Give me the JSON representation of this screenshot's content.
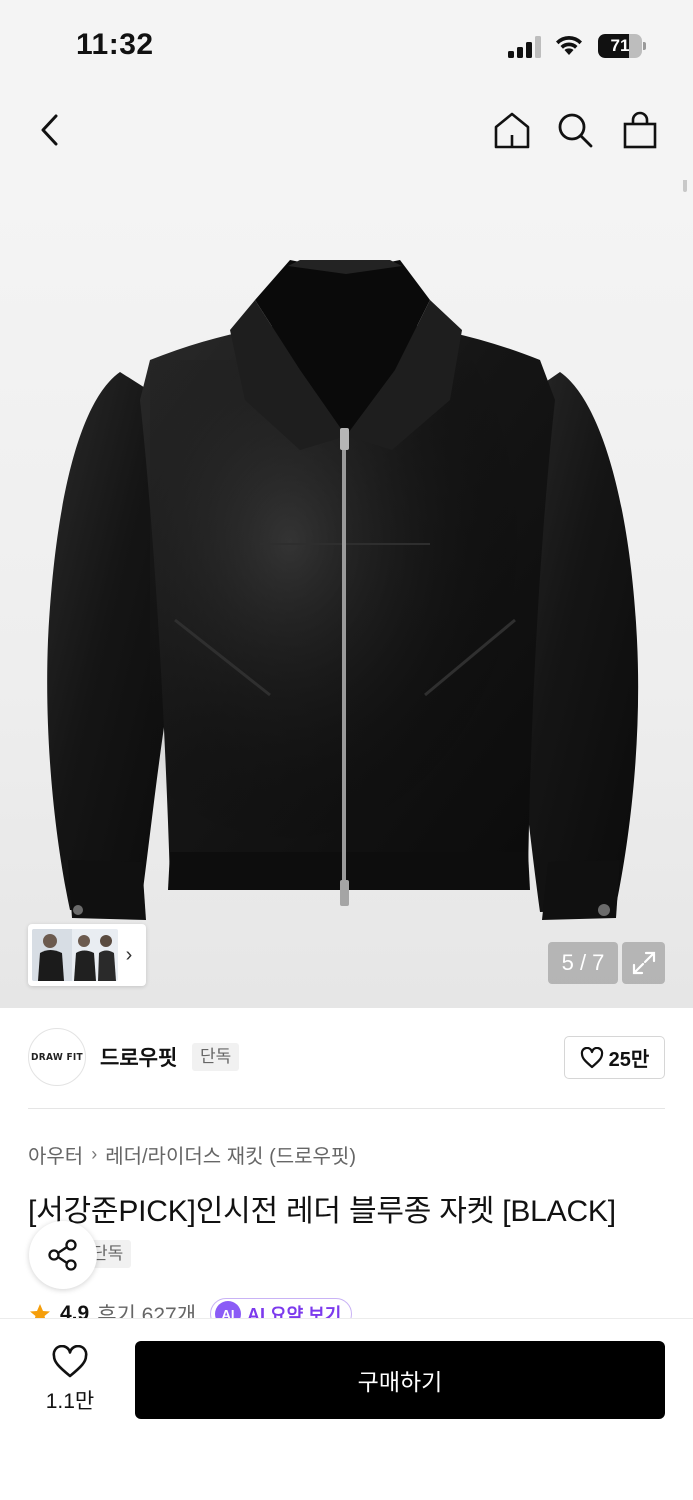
{
  "status_bar": {
    "time": "11:32",
    "battery_level": "71"
  },
  "nav": {
    "back_icon": "chevron-left-icon",
    "home_icon": "home-icon",
    "search_icon": "search-icon",
    "cart_icon": "shopping-bag-icon"
  },
  "gallery": {
    "current": 5,
    "total": 7,
    "counter_text": "5 / 7",
    "thumb_chevron": "›"
  },
  "brand": {
    "logo_text": "DRAW FIT",
    "name": "드로우핏",
    "badge": "단독",
    "likes": "25만"
  },
  "breadcrumb": [
    "아우터",
    "레더/라이더스 재킷 (드로우핏)"
  ],
  "product": {
    "title": "[서강준PICK]인시전 레더 블루종 자켓 [BLACK]",
    "exclusive_badge": "단독",
    "rating": "4.9",
    "reviews": "후기 627개",
    "ai_label": "AI",
    "ai_summary": "AI 요약 보기"
  },
  "bottom_bar": {
    "wish_count": "1.1만",
    "buy_label": "구매하기"
  },
  "colors": {
    "accent_purple": "#7c3aed",
    "star": "#f59e0b",
    "buy_button": "#000000"
  }
}
